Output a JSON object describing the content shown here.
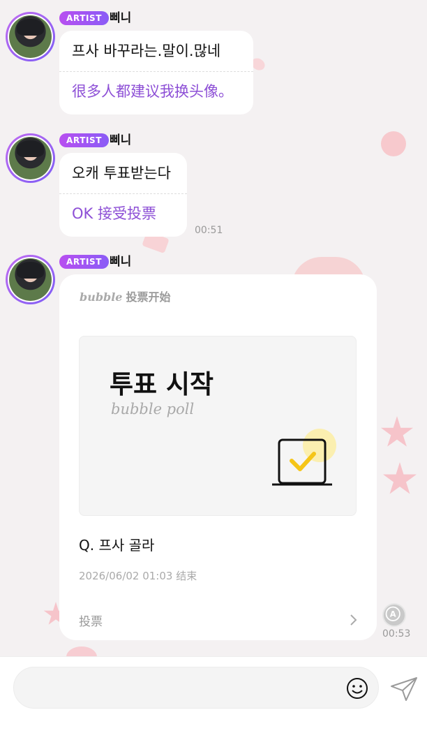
{
  "messages": [
    {
      "badge": "ARTIST",
      "name": "삐니",
      "original": "프사 바꾸라는.말이.많네",
      "translation": "很多人都建议我换头像。",
      "time": ""
    },
    {
      "badge": "ARTIST",
      "name": "삐니",
      "original": "오캐 투표받는다",
      "translation": "OK 接受投票",
      "time": "00:51"
    }
  ],
  "poll_message": {
    "badge": "ARTIST",
    "name": "삐니",
    "header_brand": "bubble",
    "header_title": "投票开始",
    "title": "투표 시작",
    "subtitle": "bubble poll",
    "question": "Q. 프사 골라",
    "end_time": "2026/06/02 01:03 结束",
    "vote_label": "投票",
    "time": "00:53"
  },
  "icons": {
    "translate": "translate-icon",
    "emoji": "smiley-icon",
    "send": "paper-plane-icon",
    "chevron": "chevron-right-icon",
    "poll": "laptop-check-icon"
  },
  "colors": {
    "accent_purple": "#8d4fd6",
    "badge_gradient_start": "#b84ff0",
    "badge_gradient_end": "#8a5cf6",
    "check_yellow": "#f5c518"
  }
}
